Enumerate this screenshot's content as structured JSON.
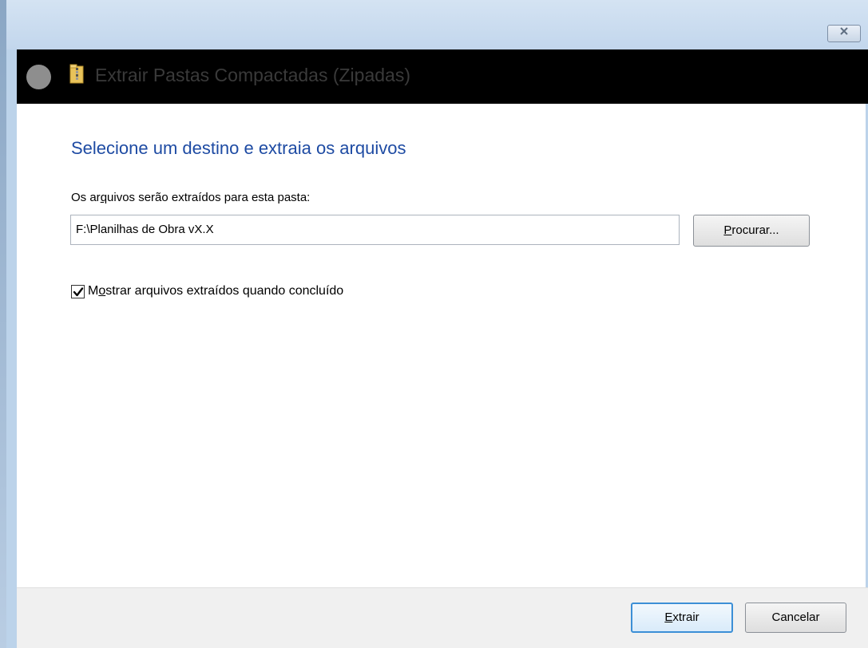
{
  "window": {
    "close_glyph": "☒"
  },
  "header": {
    "title": "Extrair Pastas Compactadas (Zipadas)",
    "icon": "zip-folder-icon",
    "back_icon": "back-circle-icon"
  },
  "main": {
    "heading": "Selecione um destino e extraia os arquivos",
    "dest_label_pre": "Os ar",
    "dest_label_u": "q",
    "dest_label_post": "uivos serão extraídos para esta pasta:",
    "path_value": "F:\\Planilhas de Obra vX.X",
    "browse_u": "P",
    "browse_rest": "rocurar...",
    "checkbox_checked": true,
    "checkbox_pre": "M",
    "checkbox_u": "o",
    "checkbox_post": "strar arquivos extraídos quando concluído"
  },
  "footer": {
    "extract_u": "E",
    "extract_rest": "xtrair",
    "cancel_label": "Cancelar"
  },
  "colors": {
    "heading": "#1e4ba3",
    "header_bg": "#000000",
    "focus_border": "#3c8fd6"
  }
}
